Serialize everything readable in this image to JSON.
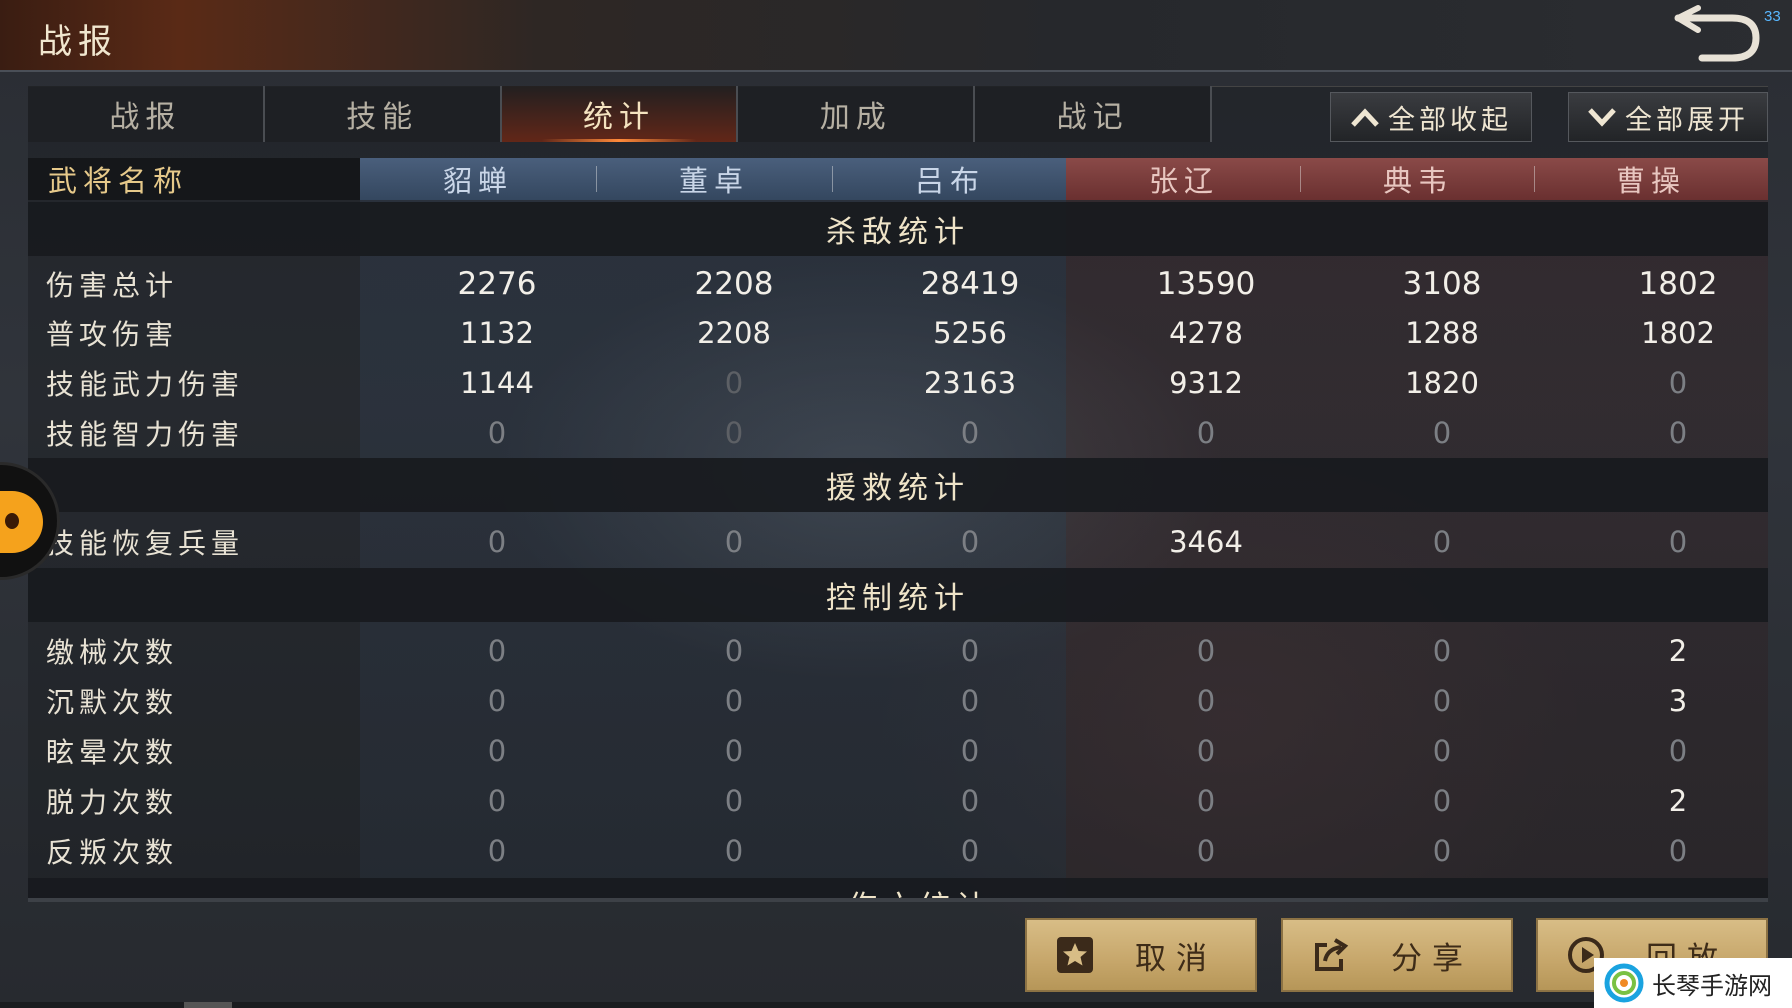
{
  "title": "战报",
  "fps": "33",
  "tabs": [
    "战报",
    "技能",
    "统计",
    "加成",
    "战记"
  ],
  "active_tab": 2,
  "controls": {
    "collapse_all": "全部收起",
    "expand_all": "全部展开"
  },
  "header": {
    "label": "武将名称",
    "generals": [
      {
        "name": "貂蝉",
        "side": "blue"
      },
      {
        "name": "董卓",
        "side": "blue"
      },
      {
        "name": "吕布",
        "side": "blue"
      },
      {
        "name": "张辽",
        "side": "red"
      },
      {
        "name": "典韦",
        "side": "red"
      },
      {
        "name": "曹操",
        "side": "red"
      }
    ]
  },
  "sections": [
    {
      "title": "杀敌统计",
      "rows": [
        {
          "label": "伤害总计",
          "values": [
            "2276",
            "2208",
            "28419",
            "13590",
            "3108",
            "1802"
          ]
        },
        {
          "label": "普攻伤害",
          "values": [
            "1132",
            "2208",
            "5256",
            "4278",
            "1288",
            "1802"
          ]
        },
        {
          "label": "技能武力伤害",
          "values": [
            "1144",
            "0",
            "23163",
            "9312",
            "1820",
            "0"
          ]
        },
        {
          "label": "技能智力伤害",
          "values": [
            "0",
            "0",
            "0",
            "0",
            "0",
            "0"
          ]
        }
      ]
    },
    {
      "title": "援救统计",
      "rows": [
        {
          "label": "技能恢复兵量",
          "values": [
            "0",
            "0",
            "0",
            "3464",
            "0",
            "0"
          ]
        }
      ]
    },
    {
      "title": "控制统计",
      "rows": [
        {
          "label": "缴械次数",
          "values": [
            "0",
            "0",
            "0",
            "0",
            "0",
            "2"
          ]
        },
        {
          "label": "沉默次数",
          "values": [
            "0",
            "0",
            "0",
            "0",
            "0",
            "3"
          ]
        },
        {
          "label": "眩晕次数",
          "values": [
            "0",
            "0",
            "0",
            "0",
            "0",
            "0"
          ]
        },
        {
          "label": "脱力次数",
          "values": [
            "0",
            "0",
            "0",
            "0",
            "0",
            "2"
          ]
        },
        {
          "label": "反叛次数",
          "values": [
            "0",
            "0",
            "0",
            "0",
            "0",
            "0"
          ]
        }
      ]
    }
  ],
  "peek_section_title": "伤亡统计",
  "buttons": {
    "cancel": "取消",
    "share": "分享",
    "replay": "回放"
  },
  "watermark": "长琴手游网",
  "icons": {
    "back": "back-arrow-icon",
    "collapse": "chevron-up-icon",
    "expand": "chevron-down-icon",
    "cancel": "star-icon",
    "share": "share-icon",
    "replay": "play-icon"
  }
}
